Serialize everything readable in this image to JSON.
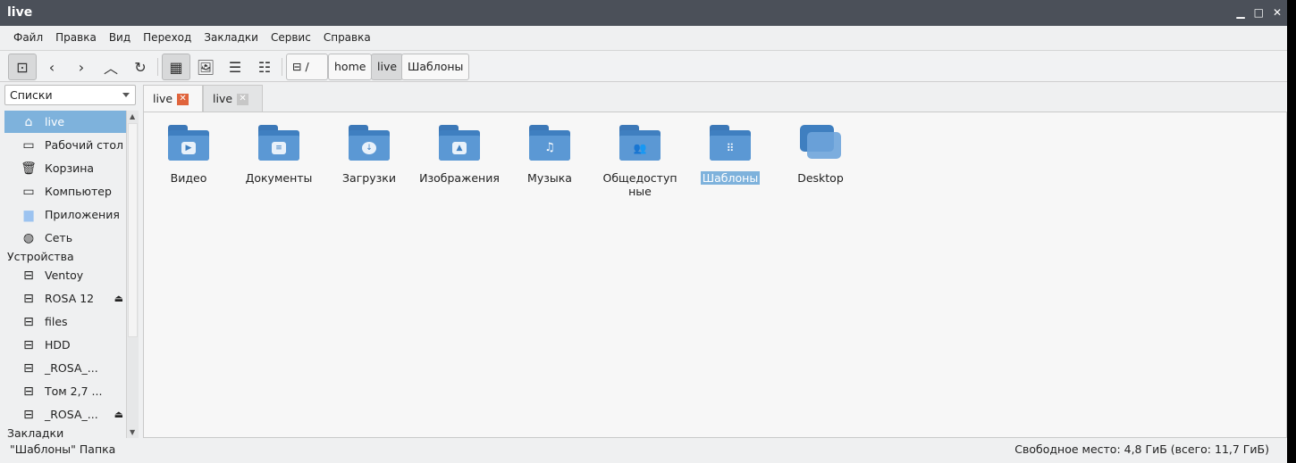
{
  "window": {
    "title": "live"
  },
  "menu": [
    "Файл",
    "Правка",
    "Вид",
    "Переход",
    "Закладки",
    "Сервис",
    "Справка"
  ],
  "breadcrumb": [
    "/",
    "home",
    "live",
    "Шаблоны"
  ],
  "sidebar": {
    "mode": "Списки",
    "places": [
      "live",
      "Рабочий стол",
      "Корзина",
      "Компьютер",
      "Приложения",
      "Сеть"
    ],
    "devices_header": "Устройства",
    "devices": [
      "Ventoy",
      "ROSA 12",
      "files",
      "HDD",
      "_ROSA_...",
      "Том 2,7 ...",
      "_ROSA_..."
    ],
    "bookmarks_header": "Закладки"
  },
  "tabs": [
    "live",
    "live"
  ],
  "files": [
    "Видео",
    "Документы",
    "Загрузки",
    "Изображения",
    "Музыка",
    "Общедоступные",
    "Шаблоны",
    "Desktop"
  ],
  "status": {
    "left": "\"Шаблоны\" Папка",
    "right": "Свободное место: 4,8 ГиБ (всего: 11,7 ГиБ)"
  }
}
